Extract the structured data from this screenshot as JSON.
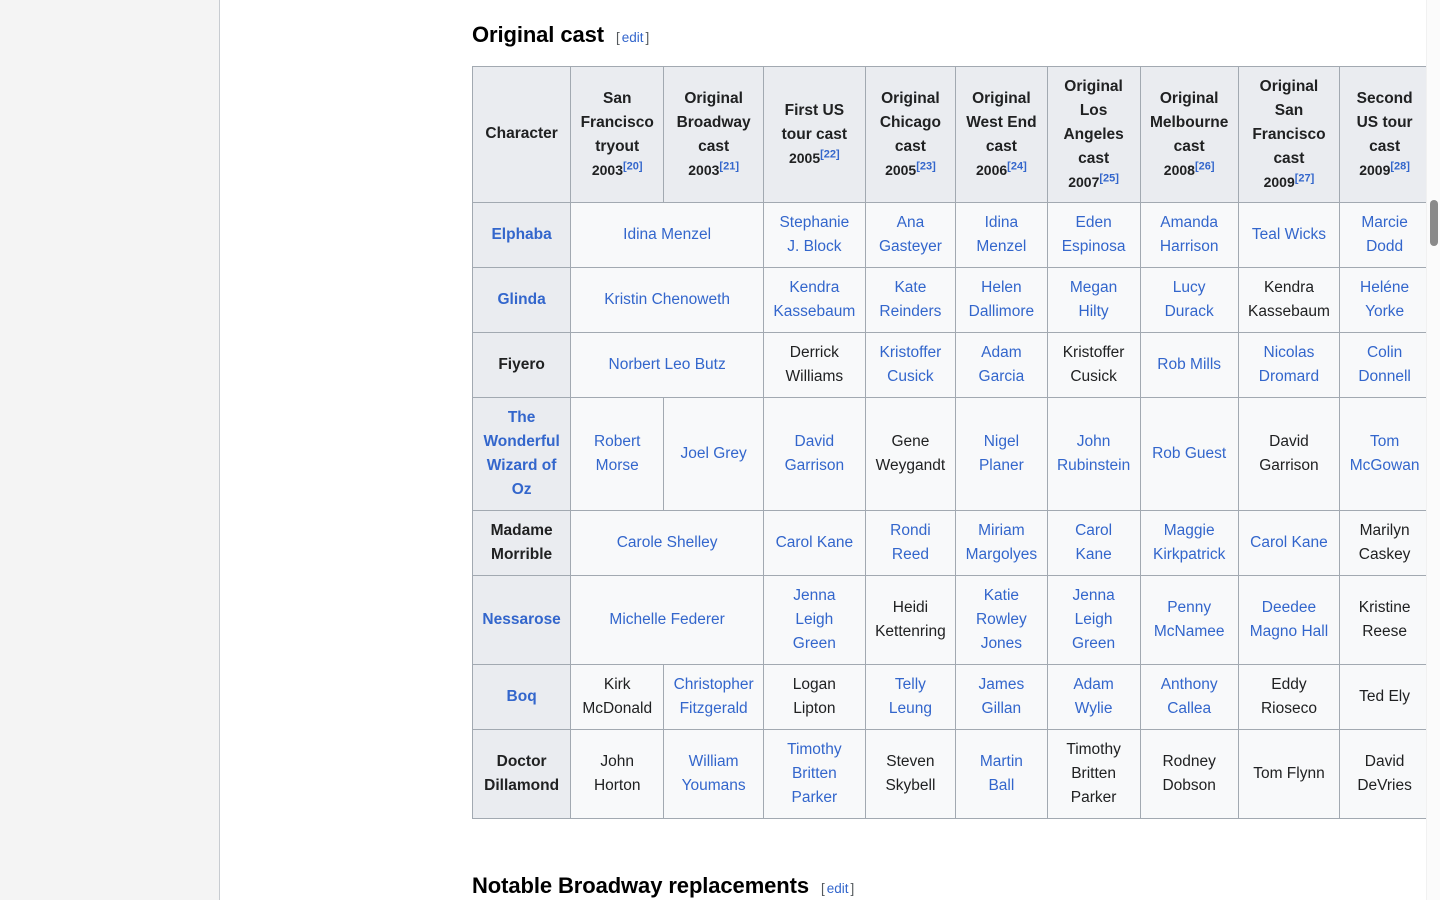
{
  "sections": {
    "original_cast": {
      "title": "Original cast",
      "edit_label": "edit",
      "bracket_open": "[",
      "bracket_close": "]"
    },
    "notable_replacements": {
      "title": "Notable Broadway replacements",
      "edit_label": "edit",
      "bracket_open": "[",
      "bracket_close": "]"
    }
  },
  "table": {
    "columns": [
      {
        "label": "Character",
        "year": "",
        "ref": ""
      },
      {
        "label": "San Francisco tryout",
        "year": "2003",
        "ref": "[20]"
      },
      {
        "label": "Original Broadway cast",
        "year": "2003",
        "ref": "[21]"
      },
      {
        "label": "First US tour cast",
        "year": "2005",
        "ref": "[22]"
      },
      {
        "label": "Original Chicago cast",
        "year": "2005",
        "ref": "[23]"
      },
      {
        "label": "Original West End cast",
        "year": "2006",
        "ref": "[24]"
      },
      {
        "label": "Original Los Angeles cast",
        "year": "2007",
        "ref": "[25]"
      },
      {
        "label": "Original Melbourne cast",
        "year": "2008",
        "ref": "[26]"
      },
      {
        "label": "Original San Francisco cast",
        "year": "2009",
        "ref": "[27]"
      },
      {
        "label": "Second US tour cast",
        "year": "2009",
        "ref": "[28]"
      }
    ],
    "rows": [
      {
        "character": "Elphaba",
        "character_link": true,
        "merged_sf_broadway": true,
        "cells": [
          {
            "text": "Idina Menzel",
            "link": true,
            "colspan": 2
          },
          {
            "text": "Stephanie J. Block",
            "link": true
          },
          {
            "text": "Ana Gasteyer",
            "link": true
          },
          {
            "text": "Idina Menzel",
            "link": true
          },
          {
            "text": "Eden Espinosa",
            "link": true
          },
          {
            "text": "Amanda Harrison",
            "link": true
          },
          {
            "text": "Teal Wicks",
            "link": true
          },
          {
            "text": "Marcie Dodd",
            "link": true
          }
        ]
      },
      {
        "character": "Glinda",
        "character_link": true,
        "merged_sf_broadway": true,
        "cells": [
          {
            "text": "Kristin Chenoweth",
            "link": true,
            "colspan": 2
          },
          {
            "text": "Kendra Kassebaum",
            "link": true
          },
          {
            "text": "Kate Reinders",
            "link": true
          },
          {
            "text": "Helen Dallimore",
            "link": true
          },
          {
            "text": "Megan Hilty",
            "link": true
          },
          {
            "text": "Lucy Durack",
            "link": true
          },
          {
            "text": "Kendra Kassebaum",
            "link": false
          },
          {
            "text": "Heléne Yorke",
            "link": true
          }
        ]
      },
      {
        "character": "Fiyero",
        "character_link": false,
        "merged_sf_broadway": true,
        "cells": [
          {
            "text": "Norbert Leo Butz",
            "link": true,
            "colspan": 2
          },
          {
            "text": "Derrick Williams",
            "link": false
          },
          {
            "text": "Kristoffer Cusick",
            "link": true
          },
          {
            "text": "Adam Garcia",
            "link": true
          },
          {
            "text": "Kristoffer Cusick",
            "link": false
          },
          {
            "text": "Rob Mills",
            "link": true
          },
          {
            "text": "Nicolas Dromard",
            "link": true
          },
          {
            "text": "Colin Donnell",
            "link": true
          }
        ]
      },
      {
        "character": "The Wonderful Wizard of Oz",
        "character_link": true,
        "merged_sf_broadway": false,
        "cells": [
          {
            "text": "Robert Morse",
            "link": true
          },
          {
            "text": "Joel Grey",
            "link": true
          },
          {
            "text": "David Garrison",
            "link": true
          },
          {
            "text": "Gene Weygandt",
            "link": false
          },
          {
            "text": "Nigel Planer",
            "link": true
          },
          {
            "text": "John Rubinstein",
            "link": true
          },
          {
            "text": "Rob Guest",
            "link": true
          },
          {
            "text": "David Garrison",
            "link": false
          },
          {
            "text": "Tom McGowan",
            "link": true
          }
        ]
      },
      {
        "character": "Madame Morrible",
        "character_link": false,
        "merged_sf_broadway": true,
        "cells": [
          {
            "text": "Carole Shelley",
            "link": true,
            "colspan": 2
          },
          {
            "text": "Carol Kane",
            "link": true
          },
          {
            "text": "Rondi Reed",
            "link": true
          },
          {
            "text": "Miriam Margolyes",
            "link": true
          },
          {
            "text": "Carol Kane",
            "link": true
          },
          {
            "text": "Maggie Kirkpatrick",
            "link": true
          },
          {
            "text": "Carol Kane",
            "link": true
          },
          {
            "text": "Marilyn Caskey",
            "link": false
          }
        ]
      },
      {
        "character": "Nessarose",
        "character_link": true,
        "merged_sf_broadway": true,
        "cells": [
          {
            "text": "Michelle Federer",
            "link": true,
            "colspan": 2
          },
          {
            "text": "Jenna Leigh Green",
            "link": true
          },
          {
            "text": "Heidi Kettenring",
            "link": false
          },
          {
            "text": "Katie Rowley Jones",
            "link": true
          },
          {
            "text": "Jenna Leigh Green",
            "link": true
          },
          {
            "text": "Penny McNamee",
            "link": true
          },
          {
            "text": "Deedee Magno Hall",
            "link": true
          },
          {
            "text": "Kristine Reese",
            "link": false
          }
        ]
      },
      {
        "character": "Boq",
        "character_link": true,
        "merged_sf_broadway": false,
        "cells": [
          {
            "text": "Kirk McDonald",
            "link": false
          },
          {
            "text": "Christopher Fitzgerald",
            "link": true
          },
          {
            "text": "Logan Lipton",
            "link": false
          },
          {
            "text": "Telly Leung",
            "link": true
          },
          {
            "text": "James Gillan",
            "link": true
          },
          {
            "text": "Adam Wylie",
            "link": true
          },
          {
            "text": "Anthony Callea",
            "link": true
          },
          {
            "text": "Eddy Rioseco",
            "link": false
          },
          {
            "text": "Ted Ely",
            "link": false
          }
        ]
      },
      {
        "character": "Doctor Dillamond",
        "character_link": false,
        "merged_sf_broadway": false,
        "cells": [
          {
            "text": "John Horton",
            "link": false
          },
          {
            "text": "William Youmans",
            "link": true
          },
          {
            "text": "Timothy Britten Parker",
            "link": true
          },
          {
            "text": "Steven Skybell",
            "link": false
          },
          {
            "text": "Martin Ball",
            "link": true
          },
          {
            "text": "Timothy Britten Parker",
            "link": false
          },
          {
            "text": "Rodney Dobson",
            "link": false
          },
          {
            "text": "Tom Flynn",
            "link": false
          },
          {
            "text": "David DeVries",
            "link": false
          }
        ]
      }
    ]
  },
  "colors": {
    "link": "#3366cc",
    "text": "#202122",
    "header_bg": "#eaecf0",
    "cell_bg": "#f8f9fa",
    "border": "#a2a9b1"
  }
}
